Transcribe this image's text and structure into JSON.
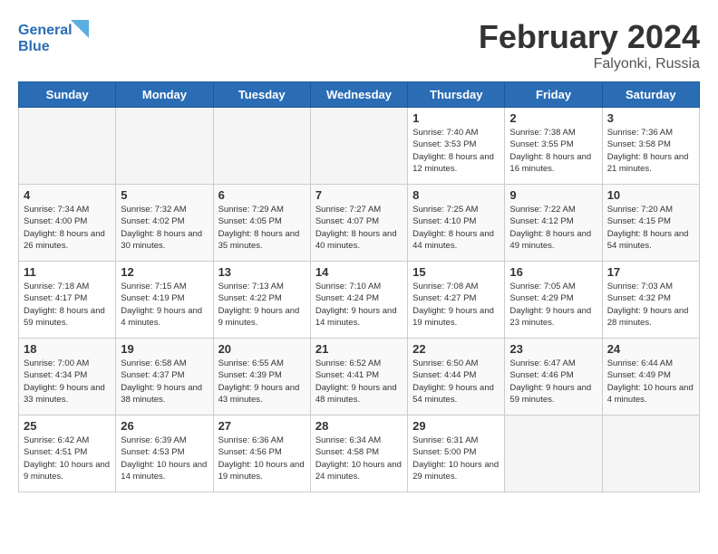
{
  "header": {
    "logo_line1": "General",
    "logo_line2": "Blue",
    "title": "February 2024",
    "subtitle": "Falyonki, Russia"
  },
  "weekdays": [
    "Sunday",
    "Monday",
    "Tuesday",
    "Wednesday",
    "Thursday",
    "Friday",
    "Saturday"
  ],
  "weeks": [
    [
      {
        "day": "",
        "info": ""
      },
      {
        "day": "",
        "info": ""
      },
      {
        "day": "",
        "info": ""
      },
      {
        "day": "",
        "info": ""
      },
      {
        "day": "1",
        "info": "Sunrise: 7:40 AM\nSunset: 3:53 PM\nDaylight: 8 hours\nand 12 minutes."
      },
      {
        "day": "2",
        "info": "Sunrise: 7:38 AM\nSunset: 3:55 PM\nDaylight: 8 hours\nand 16 minutes."
      },
      {
        "day": "3",
        "info": "Sunrise: 7:36 AM\nSunset: 3:58 PM\nDaylight: 8 hours\nand 21 minutes."
      }
    ],
    [
      {
        "day": "4",
        "info": "Sunrise: 7:34 AM\nSunset: 4:00 PM\nDaylight: 8 hours\nand 26 minutes."
      },
      {
        "day": "5",
        "info": "Sunrise: 7:32 AM\nSunset: 4:02 PM\nDaylight: 8 hours\nand 30 minutes."
      },
      {
        "day": "6",
        "info": "Sunrise: 7:29 AM\nSunset: 4:05 PM\nDaylight: 8 hours\nand 35 minutes."
      },
      {
        "day": "7",
        "info": "Sunrise: 7:27 AM\nSunset: 4:07 PM\nDaylight: 8 hours\nand 40 minutes."
      },
      {
        "day": "8",
        "info": "Sunrise: 7:25 AM\nSunset: 4:10 PM\nDaylight: 8 hours\nand 44 minutes."
      },
      {
        "day": "9",
        "info": "Sunrise: 7:22 AM\nSunset: 4:12 PM\nDaylight: 8 hours\nand 49 minutes."
      },
      {
        "day": "10",
        "info": "Sunrise: 7:20 AM\nSunset: 4:15 PM\nDaylight: 8 hours\nand 54 minutes."
      }
    ],
    [
      {
        "day": "11",
        "info": "Sunrise: 7:18 AM\nSunset: 4:17 PM\nDaylight: 8 hours\nand 59 minutes."
      },
      {
        "day": "12",
        "info": "Sunrise: 7:15 AM\nSunset: 4:19 PM\nDaylight: 9 hours\nand 4 minutes."
      },
      {
        "day": "13",
        "info": "Sunrise: 7:13 AM\nSunset: 4:22 PM\nDaylight: 9 hours\nand 9 minutes."
      },
      {
        "day": "14",
        "info": "Sunrise: 7:10 AM\nSunset: 4:24 PM\nDaylight: 9 hours\nand 14 minutes."
      },
      {
        "day": "15",
        "info": "Sunrise: 7:08 AM\nSunset: 4:27 PM\nDaylight: 9 hours\nand 19 minutes."
      },
      {
        "day": "16",
        "info": "Sunrise: 7:05 AM\nSunset: 4:29 PM\nDaylight: 9 hours\nand 23 minutes."
      },
      {
        "day": "17",
        "info": "Sunrise: 7:03 AM\nSunset: 4:32 PM\nDaylight: 9 hours\nand 28 minutes."
      }
    ],
    [
      {
        "day": "18",
        "info": "Sunrise: 7:00 AM\nSunset: 4:34 PM\nDaylight: 9 hours\nand 33 minutes."
      },
      {
        "day": "19",
        "info": "Sunrise: 6:58 AM\nSunset: 4:37 PM\nDaylight: 9 hours\nand 38 minutes."
      },
      {
        "day": "20",
        "info": "Sunrise: 6:55 AM\nSunset: 4:39 PM\nDaylight: 9 hours\nand 43 minutes."
      },
      {
        "day": "21",
        "info": "Sunrise: 6:52 AM\nSunset: 4:41 PM\nDaylight: 9 hours\nand 48 minutes."
      },
      {
        "day": "22",
        "info": "Sunrise: 6:50 AM\nSunset: 4:44 PM\nDaylight: 9 hours\nand 54 minutes."
      },
      {
        "day": "23",
        "info": "Sunrise: 6:47 AM\nSunset: 4:46 PM\nDaylight: 9 hours\nand 59 minutes."
      },
      {
        "day": "24",
        "info": "Sunrise: 6:44 AM\nSunset: 4:49 PM\nDaylight: 10 hours\nand 4 minutes."
      }
    ],
    [
      {
        "day": "25",
        "info": "Sunrise: 6:42 AM\nSunset: 4:51 PM\nDaylight: 10 hours\nand 9 minutes."
      },
      {
        "day": "26",
        "info": "Sunrise: 6:39 AM\nSunset: 4:53 PM\nDaylight: 10 hours\nand 14 minutes."
      },
      {
        "day": "27",
        "info": "Sunrise: 6:36 AM\nSunset: 4:56 PM\nDaylight: 10 hours\nand 19 minutes."
      },
      {
        "day": "28",
        "info": "Sunrise: 6:34 AM\nSunset: 4:58 PM\nDaylight: 10 hours\nand 24 minutes."
      },
      {
        "day": "29",
        "info": "Sunrise: 6:31 AM\nSunset: 5:00 PM\nDaylight: 10 hours\nand 29 minutes."
      },
      {
        "day": "",
        "info": ""
      },
      {
        "day": "",
        "info": ""
      }
    ]
  ]
}
